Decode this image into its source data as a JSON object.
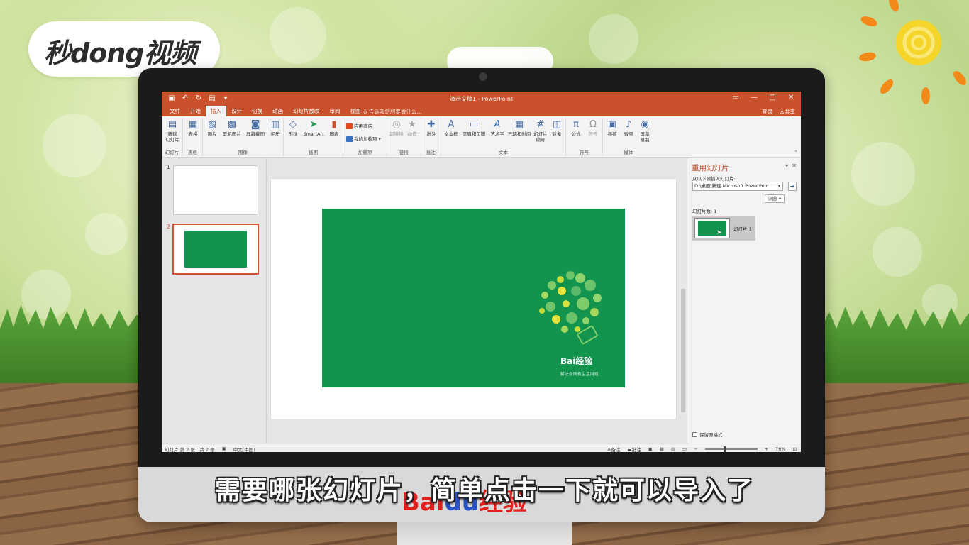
{
  "brand": {
    "logo_text": "秒dong视频",
    "caption_logo_left": "Bai",
    "caption_logo_mid": "du",
    "caption_logo_right": "经验"
  },
  "caption": "需要哪张幻灯片，简单点击一下就可以导入了",
  "window": {
    "title": "演示文稿1 - PowerPoint"
  },
  "tabs": [
    "文件",
    "开始",
    "插入",
    "设计",
    "切换",
    "动画",
    "幻灯片放映",
    "审阅",
    "视图"
  ],
  "active_tab": "插入",
  "tellme": "告诉我您想要做什么...",
  "account": {
    "login": "登录",
    "share": "共享"
  },
  "ribbon": {
    "new_slide": "新建\n幻灯片",
    "table": "表格",
    "pictures": "图片",
    "online_pictures": "联机图片",
    "screenshot": "屏幕截图",
    "album": "相册",
    "shapes": "形状",
    "smartart": "SmartArt",
    "chart": "图表",
    "store": "应用商店",
    "my_addins": "我的加载项",
    "hyperlink": "超链接",
    "action": "动作",
    "comment": "批注",
    "textbox": "文本框",
    "header_footer": "页眉和页脚",
    "wordart": "艺术字",
    "datetime": "日期和时间",
    "slide_number": "幻灯片\n编号",
    "object": "对象",
    "equation": "公式",
    "symbol": "符号",
    "video": "视频",
    "audio": "音频",
    "screen_recording": "屏幕\n录制",
    "groups": {
      "slides": "幻灯片",
      "tables": "表格",
      "images": "图像",
      "illustrations": "插图",
      "addins": "加载项",
      "links": "链接",
      "comments": "批注",
      "text": "文本",
      "symbols": "符号",
      "media": "媒体"
    }
  },
  "thumbnails": [
    {
      "number": "1"
    },
    {
      "number": "2"
    }
  ],
  "slide": {
    "logo": "Bai经验",
    "slogan": "解决你所有生活问题"
  },
  "task_pane": {
    "title": "重用幻灯片",
    "insert_from": "从以下源插入幻灯片:",
    "path": "D:\\桌面\\新建 Microsoft PowerPoin",
    "browse": "浏览",
    "slide_count": "幻灯片数: 1",
    "item_label": "幻灯片 1",
    "keep_format": "保留源格式"
  },
  "status": {
    "slide_info": "幻灯片 第 2 张，共 2 张",
    "language": "中文(中国)",
    "notes": "备注",
    "comments": "批注",
    "zoom": "76%"
  },
  "colors": {
    "accent": "#c9522d",
    "slide_green": "#12944f"
  }
}
